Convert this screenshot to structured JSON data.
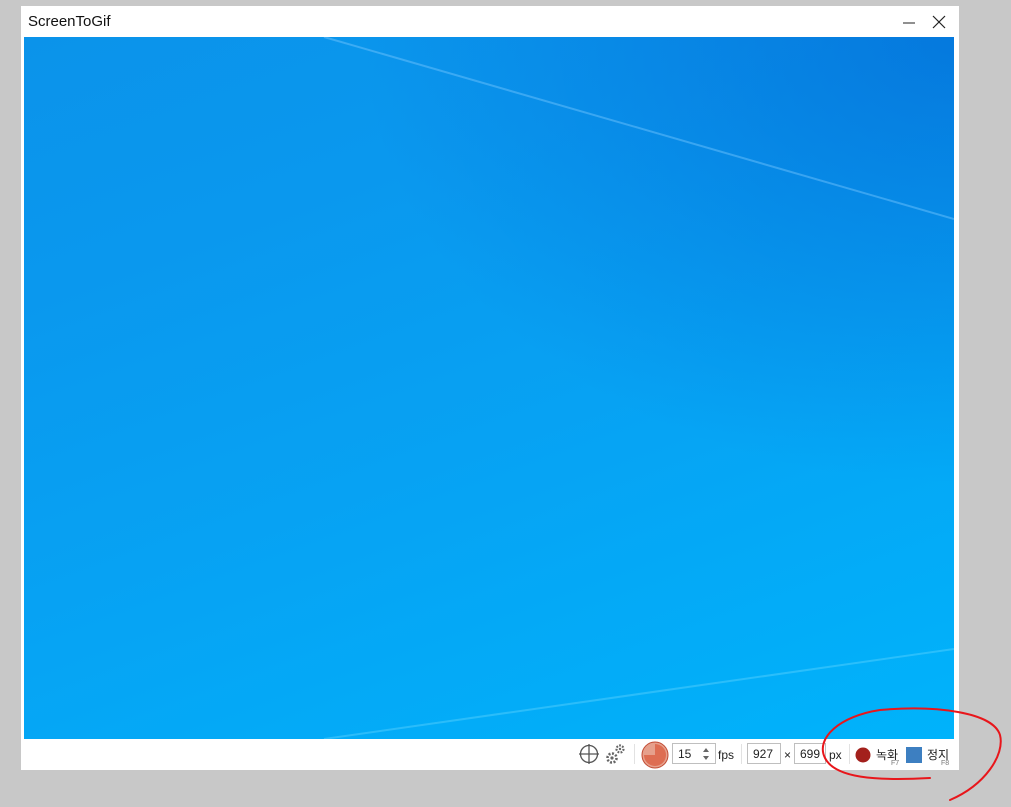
{
  "window": {
    "title": "ScreenToGif"
  },
  "toolbar": {
    "fps_value": "15",
    "fps_unit": "fps",
    "width_value": "927",
    "size_separator": "×",
    "height_value": "699",
    "size_unit": "px",
    "record_label": "녹화",
    "record_hotkey": "F7",
    "stop_label": "정지",
    "stop_hotkey": "F8"
  },
  "colors": {
    "record": "#a3201c",
    "stop": "#3d7fc1",
    "annotation": "#e8161b"
  },
  "icons": [
    "minimize-icon",
    "close-icon",
    "crosshair-icon",
    "settings-gears-icon",
    "frequency-pie-icon"
  ]
}
